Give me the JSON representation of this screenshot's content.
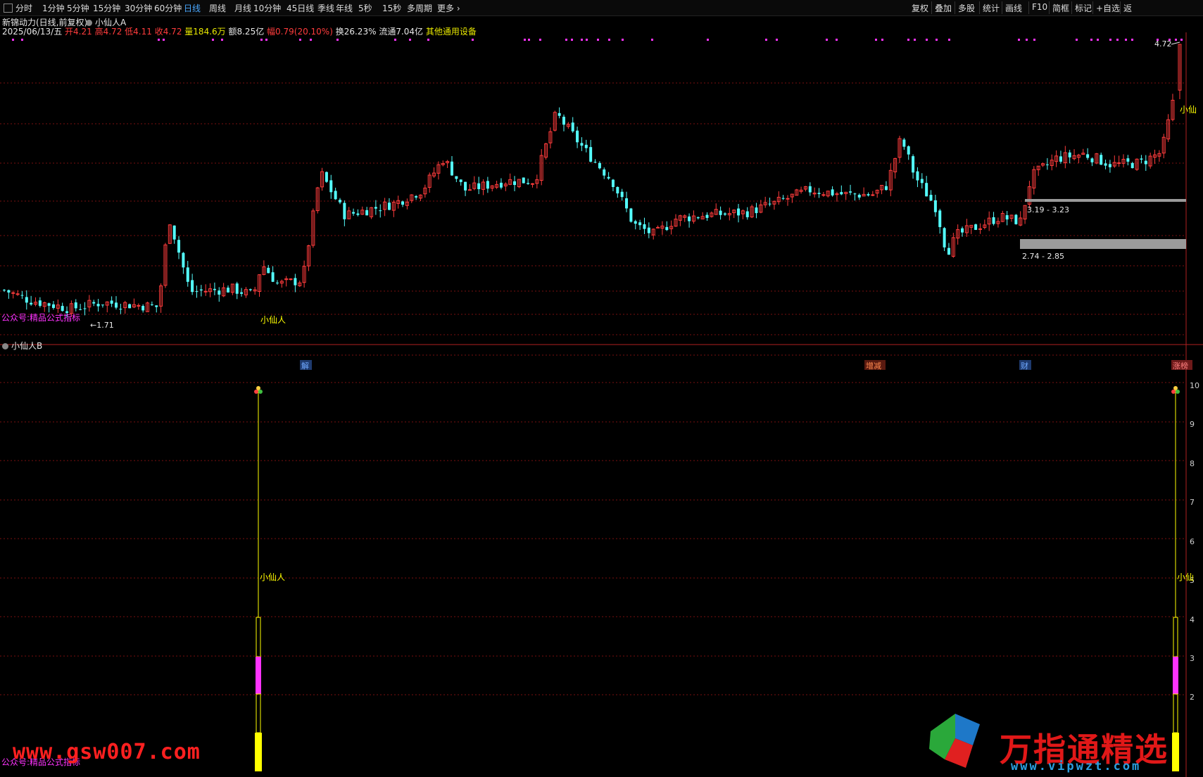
{
  "toolbar": {
    "periods": [
      "分时",
      "1分钟",
      "5分钟",
      "15分钟",
      "30分钟",
      "60分钟",
      "日线",
      "周线",
      "月线",
      "10分钟",
      "45日线",
      "季线",
      "年线",
      "5秒",
      "15秒",
      "多周期",
      "更多"
    ],
    "active": "日线",
    "right_items": [
      "复权",
      "叠加",
      "多股",
      "统计",
      "画线",
      "F10",
      "简框",
      "标记",
      "+自选",
      "返"
    ]
  },
  "header": {
    "title": "新锦动力(日线,前复权)",
    "indicator_a": "小仙人A",
    "date": "2025/06/13/五",
    "open": "开4.21",
    "high": "高4.72",
    "low": "低4.11",
    "close": "收4.72",
    "volume": "量184.6万",
    "amount": "额8.25亿",
    "change": "幅0.79(20.10%)",
    "turnover": "换26.23%",
    "float": "流通7.04亿",
    "sector": "其他通用设备"
  },
  "price_panel": {
    "label_high": "4.72",
    "label_low": "1.71",
    "zone_upper": "3.19 - 3.23",
    "zone_lower": "2.74 - 2.85",
    "signal_text": "小仙人",
    "signal_text_right": "小仙",
    "footer_left": "公众号:精品公式指标",
    "events": [
      {
        "text": "解",
        "color": "#1e3a6e",
        "textcolor": "#6fa8ff"
      },
      {
        "text": "增减",
        "color": "#5a1a10",
        "textcolor": "#ff8a50"
      },
      {
        "text": "财",
        "color": "#1e3a6e",
        "textcolor": "#6fa8ff"
      },
      {
        "text": "涨榜",
        "color": "#6e1a1a",
        "textcolor": "#ff8080"
      }
    ]
  },
  "indicator_panel": {
    "title": "小仙人B",
    "signal_text": "小仙人",
    "signal_text_right": "小仙",
    "footer_left": "公众号:精品公式指标",
    "axis_ticks": [
      "10",
      "9",
      "8",
      "7",
      "6",
      "5",
      "4",
      "3",
      "2"
    ]
  },
  "watermark": {
    "site_left": "www.gsw007.com",
    "brand": "万指通精选",
    "site_right": "www.vipwzt.com"
  },
  "colors": {
    "up": "#ff3c3c",
    "down": "#54ffff",
    "grid": "#7a1010",
    "signal": "#ffff00",
    "magenta": "#ff33ff"
  },
  "chart_data": {
    "type": "candlestick",
    "symbol": "新锦动力",
    "period": "日线,前复权",
    "last": {
      "date": "2025/06/13",
      "open": 4.21,
      "high": 4.72,
      "low": 4.11,
      "close": 4.72
    },
    "labeled_high": 4.72,
    "labeled_low": 1.71,
    "zones": [
      {
        "low": 3.19,
        "high": 3.23
      },
      {
        "low": 2.74,
        "high": 2.85
      }
    ],
    "signals": [
      "小仙人",
      "小仙人"
    ]
  }
}
